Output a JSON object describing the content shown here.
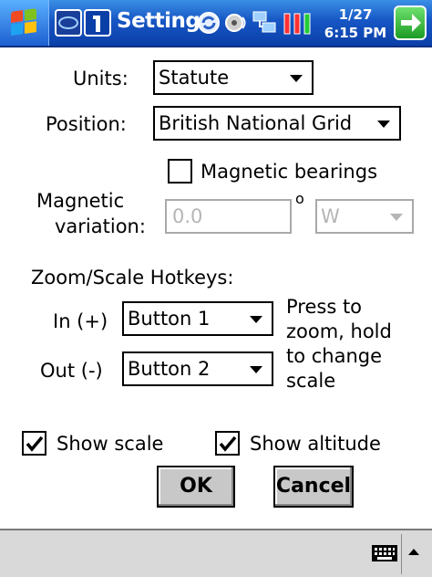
{
  "titlebar": {
    "title": "Setting",
    "clock_date": "1/27",
    "clock_time": "6:15 PM",
    "start_icon": "windows-flag-icon",
    "tray_icons": [
      "task-switcher-icon",
      "info-icon",
      "sync-icon",
      "volume-icon",
      "network-icon",
      "signal-icon"
    ]
  },
  "form": {
    "units_label": "Units:",
    "units_value": "Statute",
    "position_label": "Position:",
    "position_value": "British National Grid",
    "magnetic_bearings_label": "Magnetic bearings",
    "magnetic_bearings_checked": false,
    "magvar_label_1": "Magnetic",
    "magvar_label_2": "variation:",
    "magvar_value": "0.0",
    "degree_symbol": "o",
    "magvar_dir": "W",
    "hotkeys_heading": "Zoom/Scale Hotkeys:",
    "zoom_in_label": "In (+)",
    "zoom_in_value": "Button 1",
    "zoom_out_label": "Out (-)",
    "zoom_out_value": "Button 2",
    "hint_1": "Press to",
    "hint_2": "zoom, hold",
    "hint_3": "to change",
    "hint_4": "scale",
    "show_scale_label": "Show scale",
    "show_scale_checked": true,
    "show_altitude_label": "Show altitude",
    "show_altitude_checked": true
  },
  "buttons": {
    "ok": "OK",
    "cancel": "Cancel"
  },
  "bottombar": {
    "input_icon": "keyboard-icon"
  },
  "colors": {
    "titlebar": "#1656c4",
    "dialog_bg": "#ffffff",
    "button_face": "#c8c8c8",
    "disabled_text": "#b5b5b5"
  }
}
